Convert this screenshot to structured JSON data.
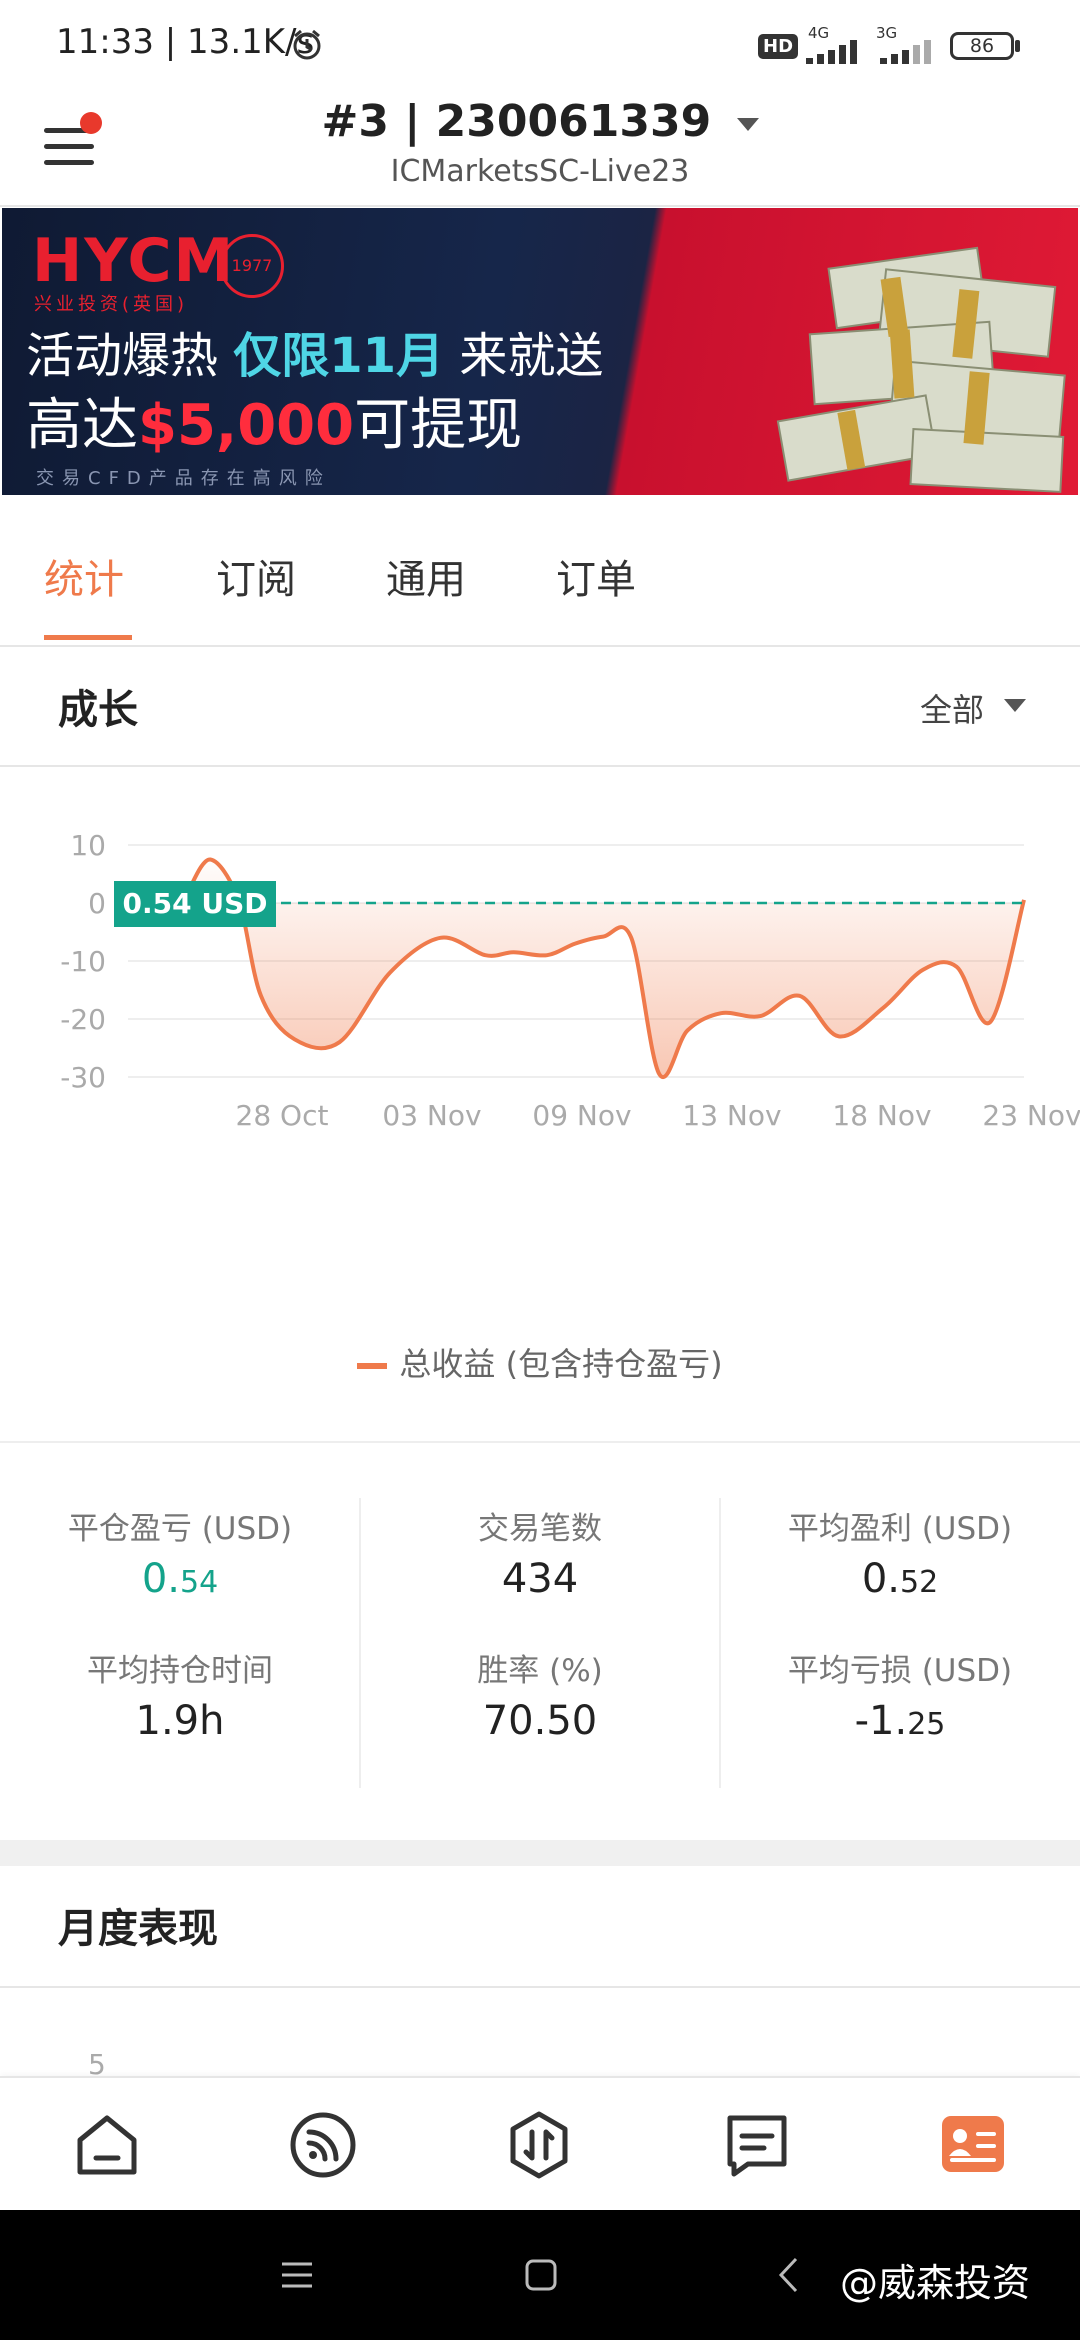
{
  "status_bar": {
    "time": "11:33 | 13.1K/s",
    "hd": "HD",
    "net1": "4G",
    "net2": "3G",
    "battery": "86"
  },
  "header": {
    "account_title": "#3 | 230061339",
    "server": "ICMarketsSC-Live23",
    "notification_dot_color": "#e8392c"
  },
  "banner": {
    "logo": "HYCM",
    "logo_sub": "兴业投资(英国)",
    "seal": "1977",
    "line1_a": "活动爆热 ",
    "line1_b": "仅限11月",
    "line1_c": " 来就送",
    "line2_a": "高达",
    "line2_b": "$5,000",
    "line2_c": "可提现",
    "risk": "交易CFD产品存在高风险"
  },
  "tabs": [
    {
      "label": "统计",
      "active": true
    },
    {
      "label": "订阅",
      "active": false
    },
    {
      "label": "通用",
      "active": false
    },
    {
      "label": "订单",
      "active": false
    }
  ],
  "growth": {
    "title": "成长",
    "range": "全部"
  },
  "chart_data": {
    "type": "area",
    "y_ticks": [
      10,
      0,
      -10,
      -20,
      -30
    ],
    "ylim": [
      -30,
      10
    ],
    "x_tick_labels": [
      "28 Oct",
      "03 Nov",
      "09 Nov",
      "13 Nov",
      "18 Nov",
      "23 Nov"
    ],
    "x_tick_index": [
      2,
      3,
      4,
      5,
      6,
      7
    ],
    "xlim": [
      0,
      7
    ],
    "current_value_label": "0.54 USD",
    "current_value": 0.54,
    "color": "#ef7a4b",
    "marker_color": "#14a38b",
    "series": [
      {
        "name": "总收益 (包含持仓盈亏)",
        "x": [
          0.55,
          0.75,
          1.0,
          1.2,
          1.5,
          1.9,
          2.35,
          2.8,
          3.2,
          3.45,
          3.75,
          4.0,
          4.25,
          4.5,
          4.75,
          5.0,
          5.3,
          5.65,
          6.0,
          6.35,
          6.75,
          7.1,
          7.4,
          7.7,
          8.0
        ],
        "values": [
          2.0,
          7.5,
          0.5,
          -16.0,
          -23.5,
          -24.0,
          -12.0,
          -6.0,
          -9.0,
          -8.5,
          -9.0,
          -7.0,
          -5.8,
          -6.0,
          -29.5,
          -22.0,
          -19.0,
          -19.5,
          -16.0,
          -23.0,
          -18.0,
          -11.5,
          -11.0,
          -20.5,
          0.54
        ]
      }
    ]
  },
  "stats": [
    {
      "label": "平仓盈亏 (USD)",
      "int": "0.",
      "dec": "54",
      "color": "#14a38b"
    },
    {
      "label": "交易笔数",
      "int": "434",
      "dec": "",
      "color": "#222222"
    },
    {
      "label": "平均盈利 (USD)",
      "int": "0.",
      "dec": "52",
      "color": "#222222"
    },
    {
      "label": "平均持仓时间",
      "int": "1.9h",
      "dec": "",
      "color": "#222222"
    },
    {
      "label": "胜率 (%)",
      "int": "70.50",
      "dec": "",
      "color": "#222222"
    },
    {
      "label": "平均亏损 (USD)",
      "int": "-1.",
      "dec": "25",
      "color": "#222222"
    }
  ],
  "monthly": {
    "title": "月度表现",
    "first_tick": "5"
  },
  "bottom_nav": [
    {
      "icon": "home-icon",
      "active": false
    },
    {
      "icon": "signal-feed-icon",
      "active": false
    },
    {
      "icon": "trade-icon",
      "active": false
    },
    {
      "icon": "message-icon",
      "active": false
    },
    {
      "icon": "profile-card-icon",
      "active": true
    }
  ],
  "watermark": "@威森投资",
  "accent_color": "#ef7a4b"
}
